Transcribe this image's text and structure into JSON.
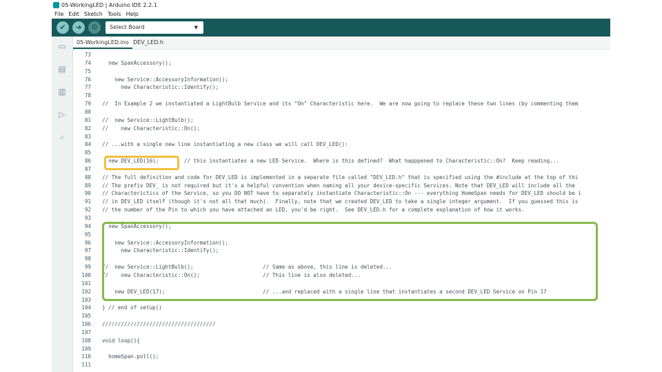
{
  "window": {
    "title": "05-WorkingLED | Arduino IDE 2.2.1"
  },
  "menu": [
    "File",
    "Edit",
    "Sketch",
    "Tools",
    "Help"
  ],
  "toolbar": {
    "verify_icon": "check-icon",
    "upload_icon": "arrow-right-icon",
    "debug_icon": "debug-icon",
    "board_select": "Select Board"
  },
  "tabs": [
    "05-WorkingLED.ino",
    "DEV_LED.h"
  ],
  "sidebar": [
    "folder-icon",
    "board-icon",
    "library-icon",
    "debug-icon",
    "search-icon"
  ],
  "code": {
    "lines": [
      {
        "n": "73",
        "text": ""
      },
      {
        "n": "74",
        "text": "  new SpanAccessory();"
      },
      {
        "n": "75",
        "text": ""
      },
      {
        "n": "76",
        "text": "    new Service::AccessoryInformation();"
      },
      {
        "n": "77",
        "text": "      new Characteristic::Identify();"
      },
      {
        "n": "78",
        "text": ""
      },
      {
        "n": "79",
        "text": "//  In Example 2 we instantiated a LightBulb Service and its \"On\" Characteristic here.  We are now going to replace these two lines (by commenting them"
      },
      {
        "n": "80",
        "text": ""
      },
      {
        "n": "81",
        "text": "//  new Service::LightBulb();"
      },
      {
        "n": "82",
        "text": "//    new Characteristic::On();"
      },
      {
        "n": "83",
        "text": ""
      },
      {
        "n": "84",
        "text": "// ...with a single new line instantiating a new class we will call DEV_LED():"
      },
      {
        "n": "85",
        "text": ""
      },
      {
        "n": "86",
        "text": "  new DEV_LED(16);        // this instantiates a new LED Service.  Where is this defined?  What happpened to Characteristic::On?  Keep reading..."
      },
      {
        "n": "87",
        "text": ""
      },
      {
        "n": "88",
        "text": "// The full definition and code for DEV_LED is implemented in a separate file called \"DEV_LED.h\" that is specified using the #include at the top of thi"
      },
      {
        "n": "89",
        "text": "// The prefix DEV_ is not required but it's a helpful convention when naming all your device-specific Services. Note that DEV_LED will include all the"
      },
      {
        "n": "90",
        "text": "// Characterictics of the Service, so you DO NOT have to separately instantiate Characteristic::On --- everything HomeSpan needs for DEV_LED should be i"
      },
      {
        "n": "91",
        "text": "// in DEV_LED itself (though it's not all that much).  Finally, note that we created DEV_LED to take a single integer argument.  If you guessed this is"
      },
      {
        "n": "92",
        "text": "// the number of the Pin to which you have attached an LED, you'd be right.  See DEV_LED.h for a complete explanation of how it works."
      },
      {
        "n": "93",
        "text": ""
      },
      {
        "n": "94",
        "text": "  new SpanAccessory();"
      },
      {
        "n": "95",
        "text": ""
      },
      {
        "n": "96",
        "text": "    new Service::AccessoryInformation();"
      },
      {
        "n": "97",
        "text": "      new Characteristic::Identify();"
      },
      {
        "n": "98",
        "text": ""
      },
      {
        "n": "99",
        "text": "//  new Service::LightBulb();                      // Same as above, this line is deleted..."
      },
      {
        "n": "100",
        "text": "//    new Characteristic::On();                    // This line is also deleted..."
      },
      {
        "n": "101",
        "text": ""
      },
      {
        "n": "102",
        "text": "    new DEV_LED(17);                               // ...and replaced with a single line that instantiates a second DEV_LED Service on Pin 17"
      },
      {
        "n": "103",
        "text": ""
      },
      {
        "n": "104",
        "text": "} // end of setup()"
      },
      {
        "n": "105",
        "text": ""
      },
      {
        "n": "106",
        "text": "////////////////////////////////////"
      },
      {
        "n": "107",
        "text": ""
      },
      {
        "n": "108",
        "text": "void loop(){"
      },
      {
        "n": "109",
        "text": ""
      },
      {
        "n": "110",
        "text": "  homeSpan.poll();"
      },
      {
        "n": "111",
        "text": ""
      }
    ]
  },
  "colors": {
    "toolbar": "#17595a",
    "highlight_orange": "#f2bf3b",
    "highlight_green": "#86b84a",
    "keyword": "#d35400",
    "comment": "#95a5a6"
  }
}
